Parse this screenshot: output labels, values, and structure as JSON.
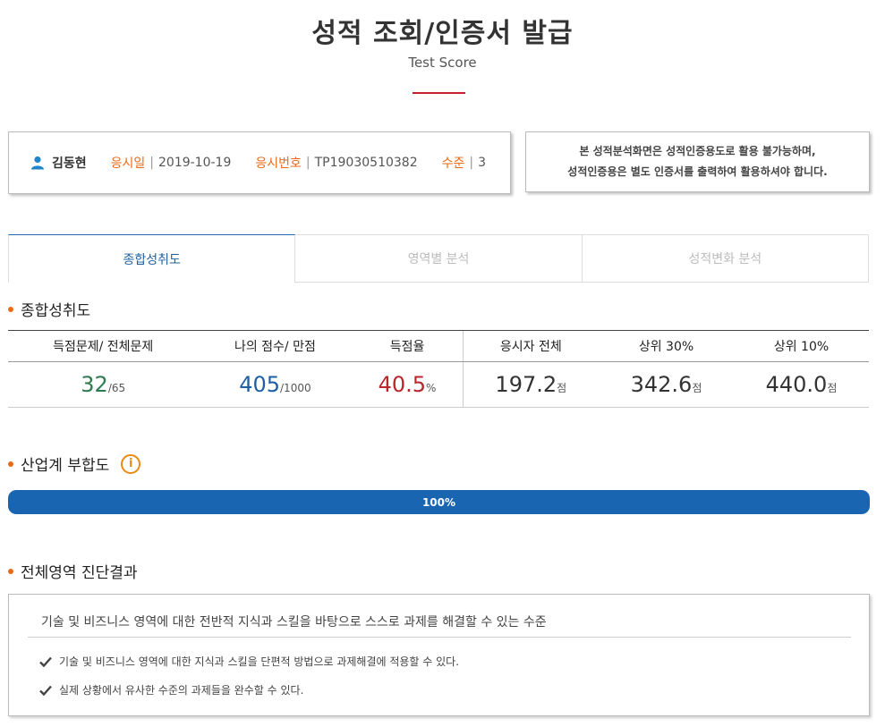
{
  "header": {
    "title": "성적 조회/인증서 발급",
    "subtitle": "Test Score"
  },
  "info": {
    "user_name": "김동현",
    "date_label": "응시일",
    "date_value": "2019-10-19",
    "exam_no_label": "응시번호",
    "exam_no_value": "TP19030510382",
    "level_label": "수준",
    "level_value": "3",
    "separator": "|"
  },
  "notice": {
    "line1": "본 성적분석화면은 성적인증용도로 활용 불가능하며,",
    "line2": "성적인증용은 별도 인증서를 출력하여 활용하셔야 합니다."
  },
  "tabs": [
    {
      "label": "종합성취도",
      "active": true
    },
    {
      "label": "영역별 분석",
      "active": false
    },
    {
      "label": "성적변화 분석",
      "active": false
    }
  ],
  "summary": {
    "title": "종합성취도",
    "headers": [
      "득점문제/ 전체문제",
      "나의 점수/ 만점",
      "득점율",
      "응시자 전체",
      "상위 30%",
      "상위 10%"
    ],
    "correct": "32",
    "correct_total": "/65",
    "score": "405",
    "score_total": "/1000",
    "rate": "40.5",
    "rate_unit": "%",
    "all_avg": "197.2",
    "top30": "342.6",
    "top10": "440.0",
    "point_unit": "점"
  },
  "industry": {
    "title": "산업계 부합도",
    "info_icon": "info-icon",
    "progress": 1.0,
    "progress_label": "100%"
  },
  "diagnosis": {
    "title": "전체영역 진단결과",
    "summary": "기술 및 비즈니스 영역에 대한 전반적 지식과 스킬을 바탕으로 스스로 과제를 해결할 수 있는 수준",
    "items": [
      "기술 및 비즈니스 영역에 대한 지식과 스킬을 단편적 방법으로 과제해결에 적용할 수 있다.",
      "실제 상황에서 유사한 수준의 과제들을 완수할 수 있다."
    ]
  },
  "colors": {
    "accent": "#ea6a16",
    "primary": "#1a65b2",
    "title_line": "#c8202a"
  }
}
